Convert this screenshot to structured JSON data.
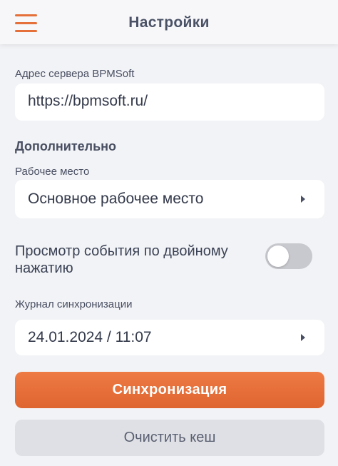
{
  "header": {
    "title": "Настройки",
    "menu_icon": "hamburger-menu-icon",
    "accent_color": "#e5703a"
  },
  "server": {
    "label": "Адрес сервера BPMSoft",
    "value": "https://bpmsoft.ru/"
  },
  "additional": {
    "section_title": "Дополнительно",
    "workplace": {
      "label": "Рабочее место",
      "value": "Основное рабочее место",
      "icon": "chevron-right-icon"
    },
    "double_tap_view": {
      "label_line1": "Просмотр события по двойному",
      "label_line2": "нажатию",
      "enabled": false
    },
    "sync_journal": {
      "label": "Журнал синхронизации",
      "value": "24.01.2024 / 11:07",
      "icon": "chevron-right-icon"
    }
  },
  "actions": {
    "sync_label": "Синхронизация",
    "clear_cache_label": "Очистить кеш",
    "primary_color": "#e5703a"
  }
}
